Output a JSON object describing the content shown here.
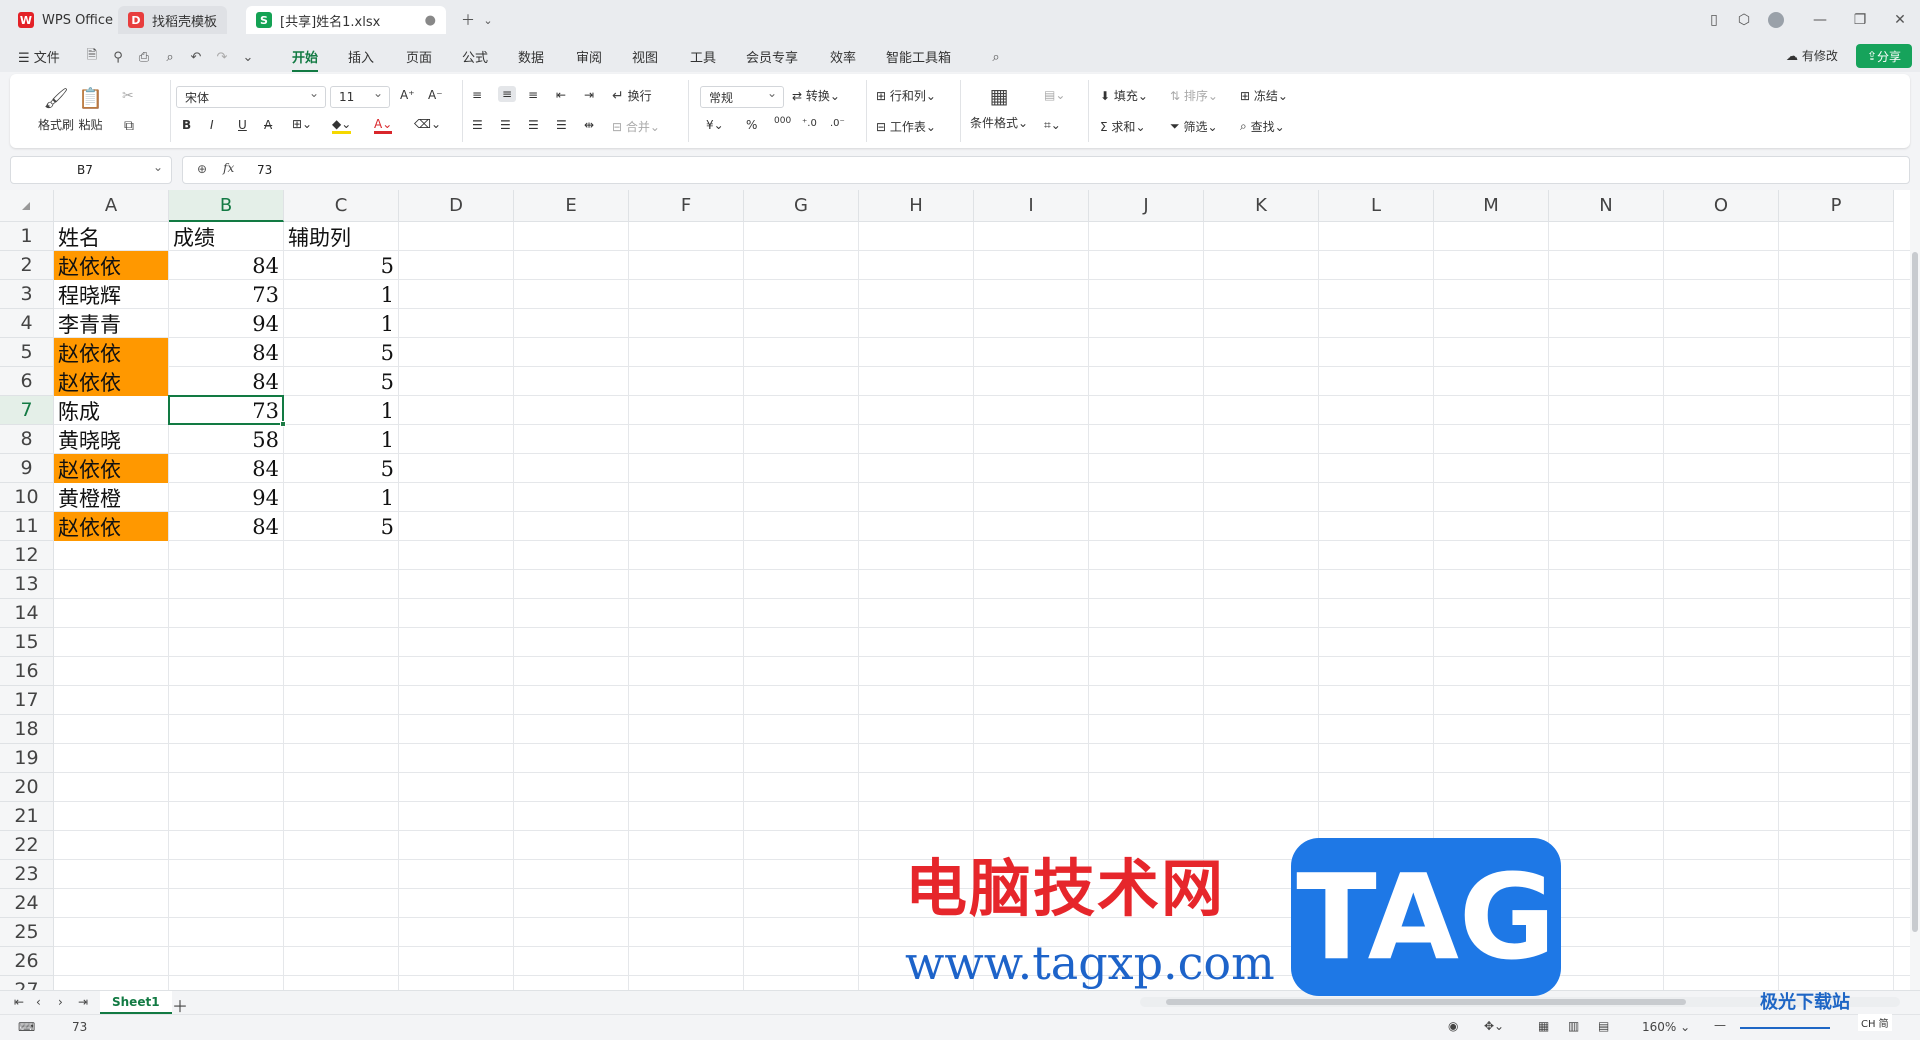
{
  "tabs": [
    {
      "label": "WPS Office",
      "logo": "W",
      "color": "#e32127"
    },
    {
      "label": "找稻壳模板",
      "logo": "D",
      "color": "#e83d3d"
    },
    {
      "label": "[共享]姓名1.xlsx",
      "logo": "S",
      "color": "#14a254"
    }
  ],
  "menu": {
    "file": "文件",
    "items": [
      "开始",
      "插入",
      "页面",
      "公式",
      "数据",
      "审阅",
      "视图",
      "工具",
      "会员专享",
      "效率",
      "智能工具箱"
    ],
    "active": "开始",
    "modified": "有修改",
    "share": "分享"
  },
  "ribbon": {
    "format_painter": "格式刷",
    "paste": "粘贴",
    "font_name": "宋体",
    "font_size": "11",
    "wrap": "换行",
    "merge": "合并",
    "number_format": "常规",
    "convert": "转换",
    "row_col": "行和列",
    "worksheet": "工作表",
    "cond_format": "条件格式",
    "fill": "填充",
    "sort": "排序",
    "freeze": "冻结",
    "sum": "求和",
    "filter": "筛选",
    "find": "查找"
  },
  "formula_bar": {
    "name_box": "B7",
    "fx": "fx",
    "value": "73"
  },
  "columns": [
    "A",
    "B",
    "C",
    "D",
    "E",
    "F",
    "G",
    "H",
    "I",
    "J",
    "K",
    "L",
    "M",
    "N",
    "O",
    "P"
  ],
  "rows": [
    "1",
    "2",
    "3",
    "4",
    "5",
    "6",
    "7",
    "8",
    "9",
    "10",
    "11",
    "12",
    "13",
    "14",
    "15",
    "16",
    "17",
    "18",
    "19",
    "20",
    "21",
    "22",
    "23",
    "24",
    "25",
    "26",
    "27"
  ],
  "table": [
    {
      "name": "姓名",
      "score": "成绩",
      "aux": "辅助列",
      "hl": false
    },
    {
      "name": "赵依依",
      "score": "84",
      "aux": "5",
      "hl": true
    },
    {
      "name": "程晓辉",
      "score": "73",
      "aux": "1",
      "hl": false
    },
    {
      "name": "李青青",
      "score": "94",
      "aux": "1",
      "hl": false
    },
    {
      "name": "赵依依",
      "score": "84",
      "aux": "5",
      "hl": true
    },
    {
      "name": "赵依依",
      "score": "84",
      "aux": "5",
      "hl": true
    },
    {
      "name": "陈成",
      "score": "73",
      "aux": "1",
      "hl": false
    },
    {
      "name": "黄晓晓",
      "score": "58",
      "aux": "1",
      "hl": false
    },
    {
      "name": "赵依依",
      "score": "84",
      "aux": "5",
      "hl": true
    },
    {
      "name": "黄橙橙",
      "score": "94",
      "aux": "1",
      "hl": false
    },
    {
      "name": "赵依依",
      "score": "84",
      "aux": "5",
      "hl": true
    }
  ],
  "selected_cell": "B7",
  "highlight_color": "#ff9800",
  "accent_color": "#127a43",
  "sheets": [
    "Sheet1"
  ],
  "status": {
    "value": "73",
    "zoom": "160%"
  },
  "watermark": {
    "cn": "电脑技术网",
    "url": "www.tagxp.com",
    "tag": "TAG",
    "site2": "极光下载站",
    "lang": "CH 简"
  }
}
